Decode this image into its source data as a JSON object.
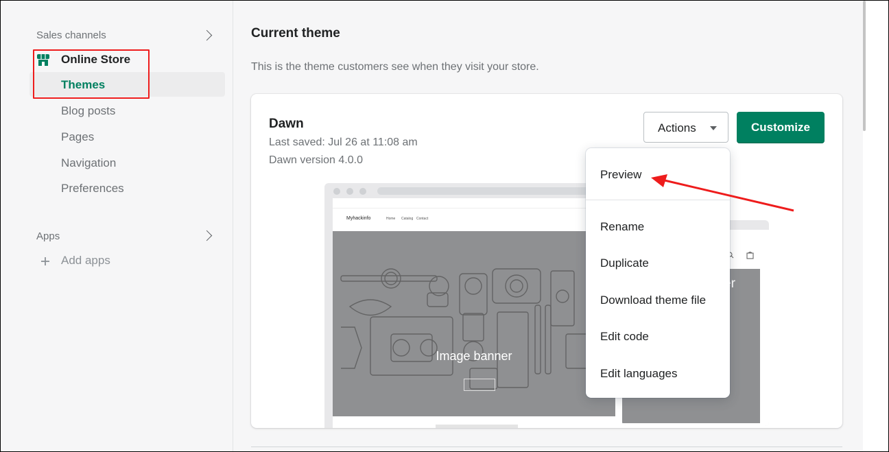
{
  "sidebar": {
    "sales_channels_label": "Sales channels",
    "online_store_label": "Online Store",
    "items": [
      {
        "label": "Themes"
      },
      {
        "label": "Blog posts"
      },
      {
        "label": "Pages"
      },
      {
        "label": "Navigation"
      },
      {
        "label": "Preferences"
      }
    ],
    "apps_label": "Apps",
    "add_apps_label": "Add apps"
  },
  "main": {
    "title": "Current theme",
    "subtitle": "This is the theme customers see when they visit your store.",
    "theme": {
      "name": "Dawn",
      "last_saved": "Last saved: Jul 26 at 11:08 am",
      "version": "Dawn version 4.0.0"
    },
    "actions_label": "Actions",
    "customize_label": "Customize",
    "preview": {
      "brand": "Myhackinfo",
      "nav": [
        "Home",
        "Catalog",
        "Contact"
      ],
      "banner_title": "Image banner",
      "mobile_text": "er"
    }
  },
  "dropdown": {
    "items": [
      {
        "label": "Preview"
      },
      {
        "label": "Rename"
      },
      {
        "label": "Duplicate"
      },
      {
        "label": "Download theme file"
      },
      {
        "label": "Edit code"
      },
      {
        "label": "Edit languages"
      }
    ]
  },
  "colors": {
    "accent": "#008060",
    "annotation": "#ee1c1c"
  }
}
